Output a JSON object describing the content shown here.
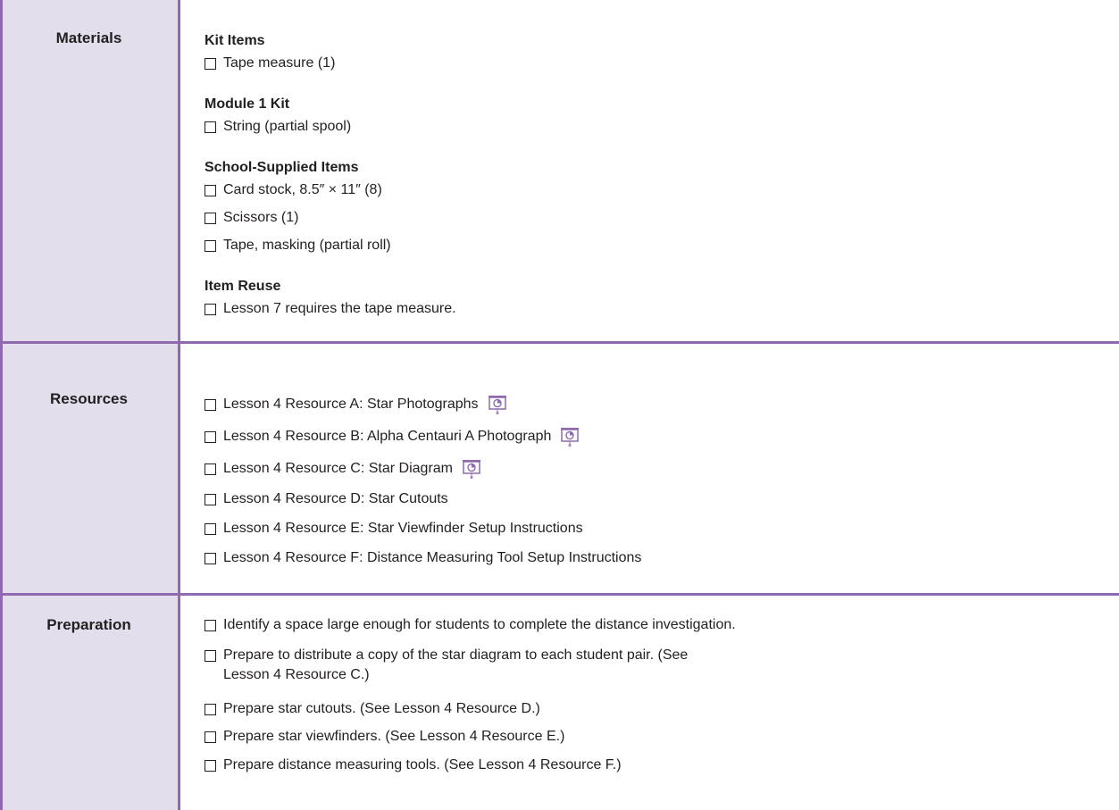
{
  "materials": {
    "label": "Materials",
    "groups": [
      {
        "heading": "Kit Items",
        "items": [
          "Tape measure (1)"
        ]
      },
      {
        "heading": "Module 1 Kit",
        "items": [
          "String (partial spool)"
        ]
      },
      {
        "heading": "School-Supplied Items",
        "items": [
          "Card stock, 8.5″ × 11″ (8)",
          "Scissors (1)",
          "Tape, masking (partial roll)"
        ]
      },
      {
        "heading": "Item Reuse",
        "items": [
          "Lesson 7 requires the tape measure."
        ]
      }
    ]
  },
  "resources": {
    "label": "Resources",
    "items": [
      {
        "text": "Lesson 4 Resource A: Star Photographs",
        "icon": "projector-screen-icon"
      },
      {
        "text": "Lesson 4 Resource B: Alpha Centauri A Photograph",
        "icon": "projector-screen-icon"
      },
      {
        "text": "Lesson 4 Resource C: Star Diagram",
        "icon": "projector-screen-icon"
      },
      {
        "text": "Lesson 4 Resource D: Star Cutouts",
        "icon": null
      },
      {
        "text": "Lesson 4 Resource E: Star Viewfinder Setup Instructions",
        "icon": null
      },
      {
        "text": "Lesson 4 Resource F: Distance Measuring Tool Setup Instructions",
        "icon": null
      }
    ]
  },
  "preparation": {
    "label": "Preparation",
    "items": [
      "Identify a space large enough for students to complete the distance investigation.",
      "Prepare to distribute a copy of the star diagram to each student pair. (See Lesson 4 Resource C.)",
      "Prepare star cutouts. (See Lesson 4 Resource D.)",
      "Prepare star viewfinders. (See Lesson 4 Resource E.)",
      "Prepare distance measuring tools. (See Lesson 4 Resource F.)"
    ]
  },
  "colors": {
    "accent": "#8f6ab0",
    "label_bg": "#e3deeb",
    "text": "#231f20"
  }
}
